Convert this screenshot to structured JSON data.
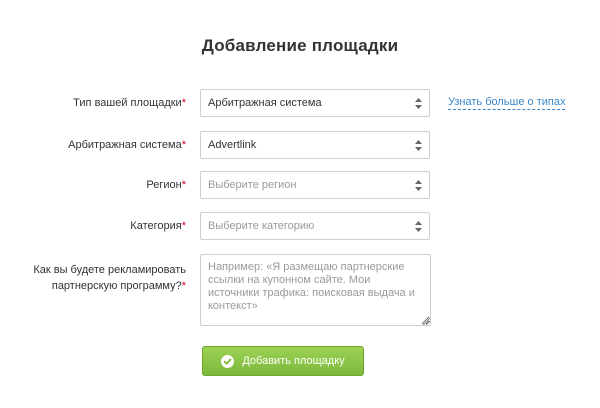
{
  "page": {
    "title": "Добавление площадки"
  },
  "form": {
    "site_type": {
      "label": "Тип вашей площадки",
      "required_mark": "*",
      "value": "Арбитражная система",
      "help_link": "Узнать больше о типах"
    },
    "arbitrage_system": {
      "label": "Арбитражная система",
      "required_mark": "*",
      "value": "Advertlink"
    },
    "region": {
      "label": "Регион",
      "required_mark": "*",
      "placeholder": "Выберите регион"
    },
    "category": {
      "label": "Категория",
      "required_mark": "*",
      "placeholder": "Выберите категорию"
    },
    "promotion": {
      "label_line1": "Как вы будете рекламировать",
      "label_line2": "партнерскую программу?",
      "required_mark": "*",
      "placeholder": "Например: «Я размещаю партнерские ссылки на купонном сайте. Мои источники трафика: поисковая выдача и контекст»",
      "value": ""
    },
    "submit_label": "Добавить площадку"
  },
  "icons": {
    "select_arrows": "up-down-arrows-icon",
    "submit": "check-circle-icon",
    "textarea_grip": "resize-grip-icon"
  },
  "colors": {
    "accent_green": "#7cb93b",
    "link_blue": "#3a87c8",
    "required_red": "#d0021b"
  }
}
